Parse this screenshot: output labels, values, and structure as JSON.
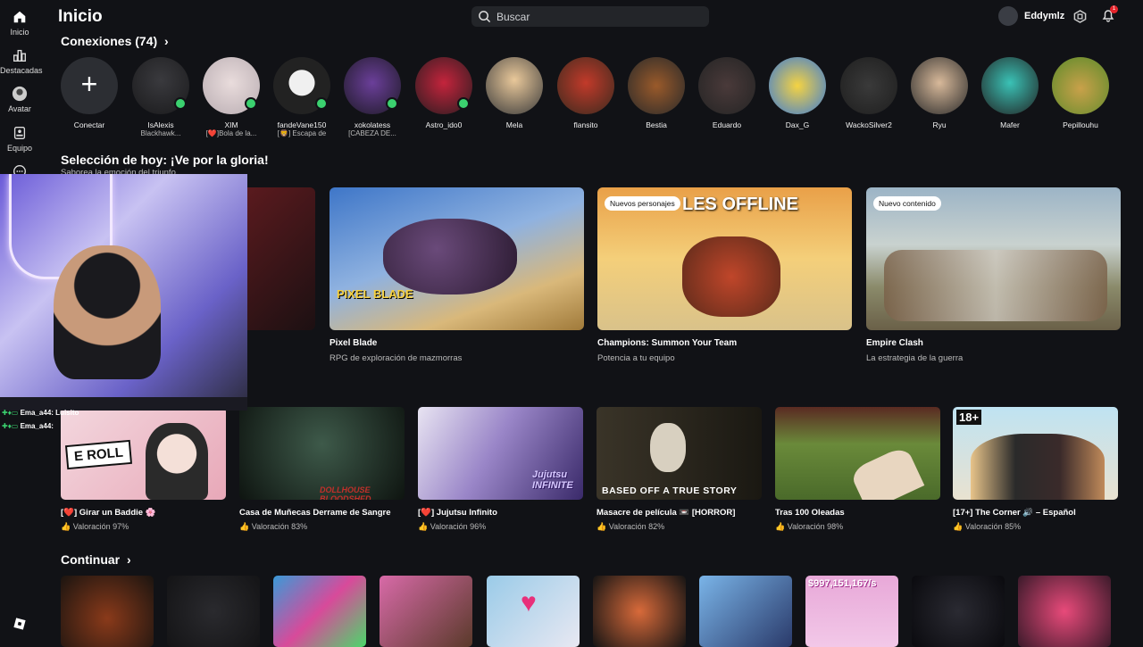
{
  "rail": {
    "items": [
      {
        "label": "Inicio",
        "icon": "home-icon"
      },
      {
        "label": "Destacadas",
        "icon": "chart-icon"
      },
      {
        "label": "Avatar",
        "icon": "avatar-icon"
      },
      {
        "label": "Equipo",
        "icon": "team-icon"
      },
      {
        "label": "",
        "icon": "more-icon"
      }
    ]
  },
  "header": {
    "title": "Inicio",
    "search_placeholder": "Buscar",
    "username": "Eddymlz",
    "notification_count": "1"
  },
  "connections": {
    "title": "Conexiones (74)",
    "items": [
      {
        "name": "Conectar",
        "status": "",
        "online": false
      },
      {
        "name": "IsAlexis",
        "status": "Blackhawk...",
        "online": true
      },
      {
        "name": "XIM",
        "status": "[❤️]Bola de la...",
        "online": true
      },
      {
        "name": "fandeVane150",
        "status": "[🦁] Escapa de",
        "online": true
      },
      {
        "name": "xokolatess",
        "status": "[CABEZA DE...",
        "online": true
      },
      {
        "name": "Astro_ido0",
        "status": "",
        "online": true
      },
      {
        "name": "Mela",
        "status": "",
        "online": false
      },
      {
        "name": "flansito",
        "status": "",
        "online": false
      },
      {
        "name": "Bestia",
        "status": "",
        "online": false
      },
      {
        "name": "Eduardo",
        "status": "",
        "online": false
      },
      {
        "name": "Dax_G",
        "status": "",
        "online": false
      },
      {
        "name": "WackoSilver2",
        "status": "",
        "online": false
      },
      {
        "name": "Ryu",
        "status": "",
        "online": false
      },
      {
        "name": "Mafer",
        "status": "",
        "online": false
      },
      {
        "name": "Pepillouhu",
        "status": "",
        "online": false
      }
    ]
  },
  "today": {
    "title": "Selección de hoy: ¡Ve por la gloria!",
    "subtitle": "Saborea la emoción del triunfo",
    "cards": [
      {
        "title": "Pixel Blade",
        "subtitle": "RPG de exploración de mazmorras",
        "tag": "",
        "thumb_text": "PIXEL BLADE"
      },
      {
        "title": "Champions: Summon Your Team",
        "subtitle": "Potencia a tu equipo",
        "tag": "Nuevos personajes",
        "thumb_text": "LES OFFLINE"
      },
      {
        "title": "Empire Clash",
        "subtitle": "La estrategia de la guerra",
        "tag": "Nuevo contenido",
        "thumb_text": ""
      }
    ]
  },
  "games": [
    {
      "title": "[❤️] Girar un Baddie 🌸",
      "rating": "Valoración 97%",
      "thumb_text": "E ROLL"
    },
    {
      "title": "Casa de Muñecas Derrame de Sangre",
      "rating": "Valoración 83%",
      "thumb_text": "DOLLHOUSE BLOODSHED"
    },
    {
      "title": "[❤️] Jujutsu Infinito",
      "rating": "Valoración 96%",
      "thumb_text": "Jujutsu INFINITE"
    },
    {
      "title": "Masacre de película 📼 [HORROR]",
      "rating": "Valoración 82%",
      "thumb_text": "BASED OFF A TRUE STORY"
    },
    {
      "title": "Tras 100 Oleadas",
      "rating": "Valoración 98%",
      "thumb_text": ""
    },
    {
      "title": "[17+] The Corner 🔊 – Español",
      "rating": "Valoración 85%",
      "thumb_text": "18+"
    }
  ],
  "continue": {
    "title": "Continuar",
    "tiles": [
      "",
      "",
      "",
      "",
      "",
      "",
      "",
      "$997,151,167/s",
      "",
      ""
    ]
  },
  "overlay": {
    "chat": [
      {
        "user": "Ema_a44",
        "text": ": Luisito"
      },
      {
        "user": "Ema_a44",
        "text": ":"
      }
    ]
  },
  "colors": {
    "background": "#111216",
    "online": "#3bd16f",
    "notification": "#e5242b"
  }
}
